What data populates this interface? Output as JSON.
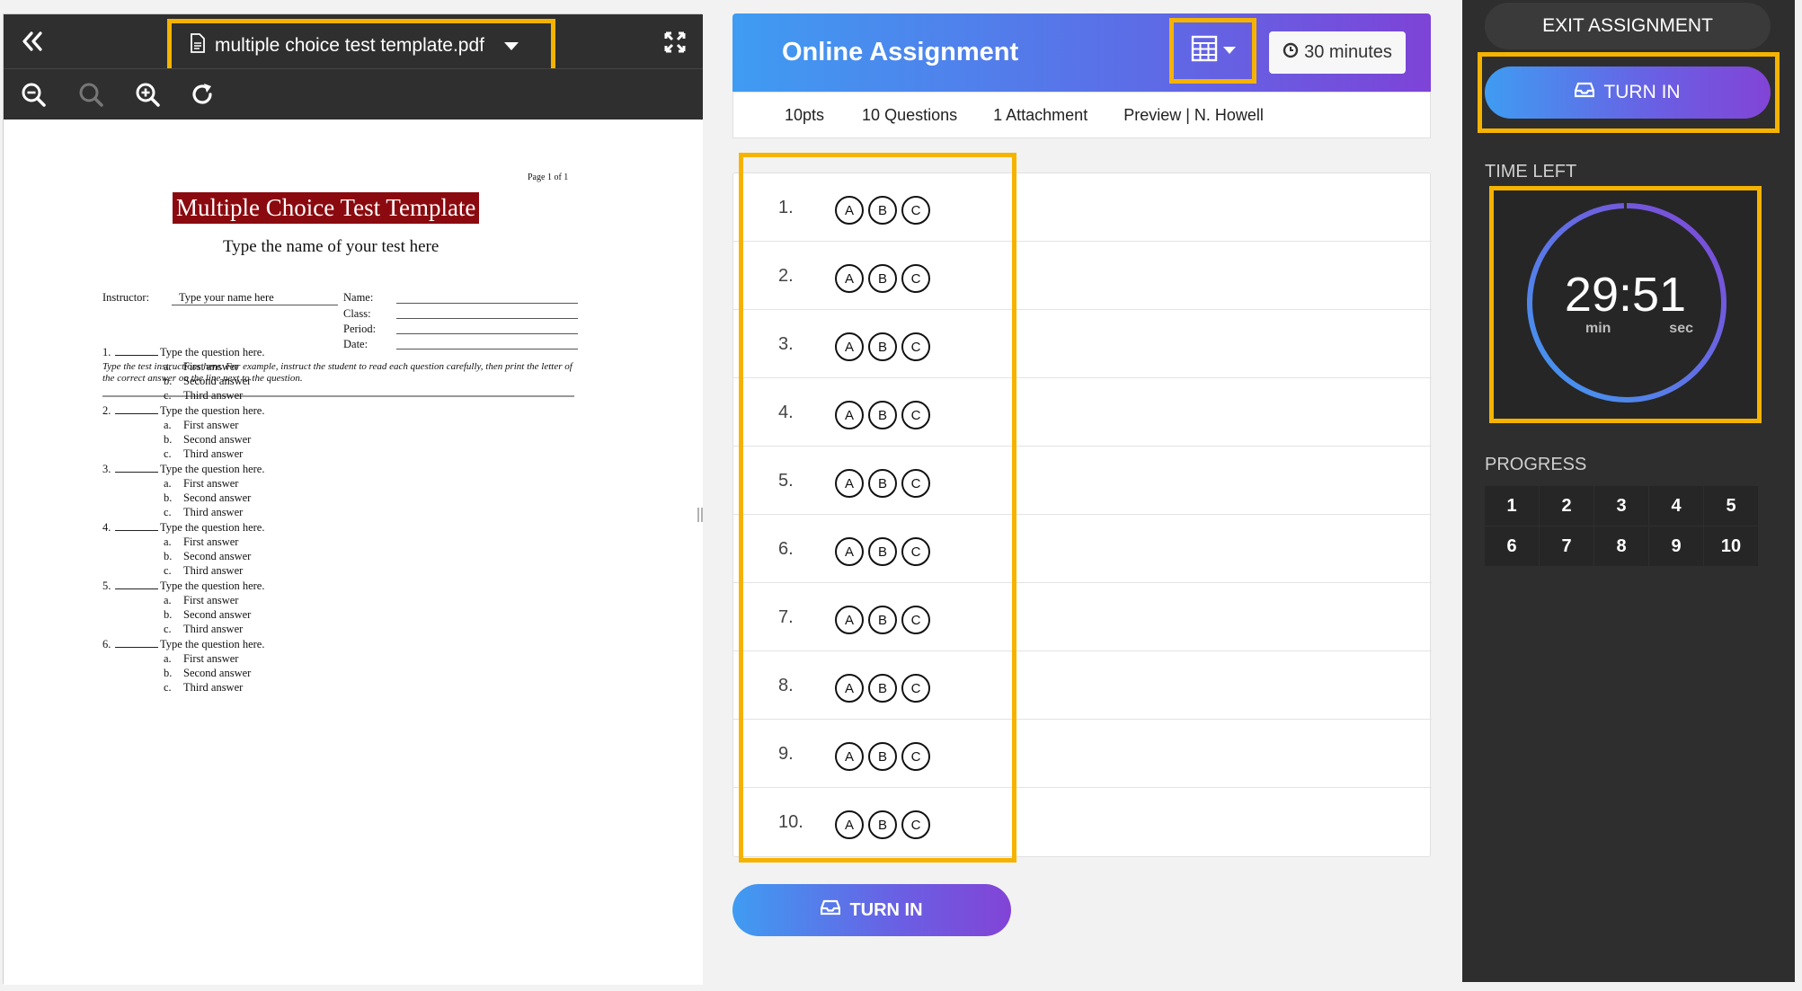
{
  "pdf_viewer": {
    "file_name": "multiple choice test template.pdf",
    "document": {
      "page_label": "Page 1 of 1",
      "title": "Multiple Choice Test Template",
      "subtitle": "Type the name of your test here",
      "instructor_label": "Instructor:",
      "instructor_value": "Type your name here",
      "name_label": "Name:",
      "class_label": "Class:",
      "period_label": "Period:",
      "date_label": "Date:",
      "instructions": "Type the test instructions here.  For example, instruct the student to read each question carefully, then print the letter of the correct answer on the line next to the question.",
      "questions": [
        {
          "num": "1.",
          "text": "Type the question here.",
          "answers": [
            {
              "letter": "a.",
              "text": "First answer"
            },
            {
              "letter": "b.",
              "text": "Second answer"
            },
            {
              "letter": "c.",
              "text": "Third answer"
            }
          ]
        },
        {
          "num": "2.",
          "text": "Type the question here.",
          "answers": [
            {
              "letter": "a.",
              "text": "First answer"
            },
            {
              "letter": "b.",
              "text": "Second answer"
            },
            {
              "letter": "c.",
              "text": "Third answer"
            }
          ]
        },
        {
          "num": "3.",
          "text": "Type the question here.",
          "answers": [
            {
              "letter": "a.",
              "text": "First answer"
            },
            {
              "letter": "b.",
              "text": "Second answer"
            },
            {
              "letter": "c.",
              "text": "Third answer"
            }
          ]
        },
        {
          "num": "4.",
          "text": "Type the question here.",
          "answers": [
            {
              "letter": "a.",
              "text": "First answer"
            },
            {
              "letter": "b.",
              "text": "Second answer"
            },
            {
              "letter": "c.",
              "text": "Third answer"
            }
          ]
        },
        {
          "num": "5.",
          "text": "Type the question here.",
          "answers": [
            {
              "letter": "a.",
              "text": "First answer"
            },
            {
              "letter": "b.",
              "text": "Second answer"
            },
            {
              "letter": "c.",
              "text": "Third answer"
            }
          ]
        },
        {
          "num": "6.",
          "text": "Type the question here.",
          "answers": [
            {
              "letter": "a.",
              "text": "First answer"
            },
            {
              "letter": "b.",
              "text": "Second answer"
            },
            {
              "letter": "c.",
              "text": "Third answer"
            }
          ]
        }
      ]
    },
    "icons": {
      "collapse": "double-chevron-left-icon",
      "file": "document-icon",
      "dropdown": "caret-down-icon",
      "fullscreen": "expand-icon",
      "zoom_out": "zoom-out-icon",
      "zoom_reset": "magnifier-icon",
      "zoom_in": "zoom-in-icon",
      "rotate": "rotate-icon"
    }
  },
  "assignment": {
    "title": "Online Assignment",
    "time_limit": "30 minutes",
    "points": "10pts",
    "questions_count": "10 Questions",
    "attachments": "1 Attachment",
    "preview": "Preview | N. Howell",
    "answer_rows": [
      {
        "num": "1.",
        "options": [
          "A",
          "B",
          "C"
        ]
      },
      {
        "num": "2.",
        "options": [
          "A",
          "B",
          "C"
        ]
      },
      {
        "num": "3.",
        "options": [
          "A",
          "B",
          "C"
        ]
      },
      {
        "num": "4.",
        "options": [
          "A",
          "B",
          "C"
        ]
      },
      {
        "num": "5.",
        "options": [
          "A",
          "B",
          "C"
        ]
      },
      {
        "num": "6.",
        "options": [
          "A",
          "B",
          "C"
        ]
      },
      {
        "num": "7.",
        "options": [
          "A",
          "B",
          "C"
        ]
      },
      {
        "num": "8.",
        "options": [
          "A",
          "B",
          "C"
        ]
      },
      {
        "num": "9.",
        "options": [
          "A",
          "B",
          "C"
        ]
      },
      {
        "num": "10.",
        "options": [
          "A",
          "B",
          "C"
        ]
      }
    ],
    "turn_in_label": "TURN IN"
  },
  "sidebar": {
    "exit_label": "EXIT ASSIGNMENT",
    "turn_in_label": "TURN IN",
    "time_left_label": "TIME LEFT",
    "timer": {
      "minutes": "29",
      "seconds": "51",
      "min_label": "min",
      "sec_label": "sec",
      "remaining_fraction": 0.995
    },
    "progress_label": "PROGRESS",
    "progress_items": [
      "1",
      "2",
      "3",
      "4",
      "5",
      "6",
      "7",
      "8",
      "9",
      "10"
    ]
  },
  "colors": {
    "highlight": "#f5b300",
    "gradient_start": "#3f9cf2",
    "gradient_end": "#8244d6",
    "sidebar_bg": "#2e2e2e",
    "pdf_title_bg": "#8b0a0f"
  }
}
